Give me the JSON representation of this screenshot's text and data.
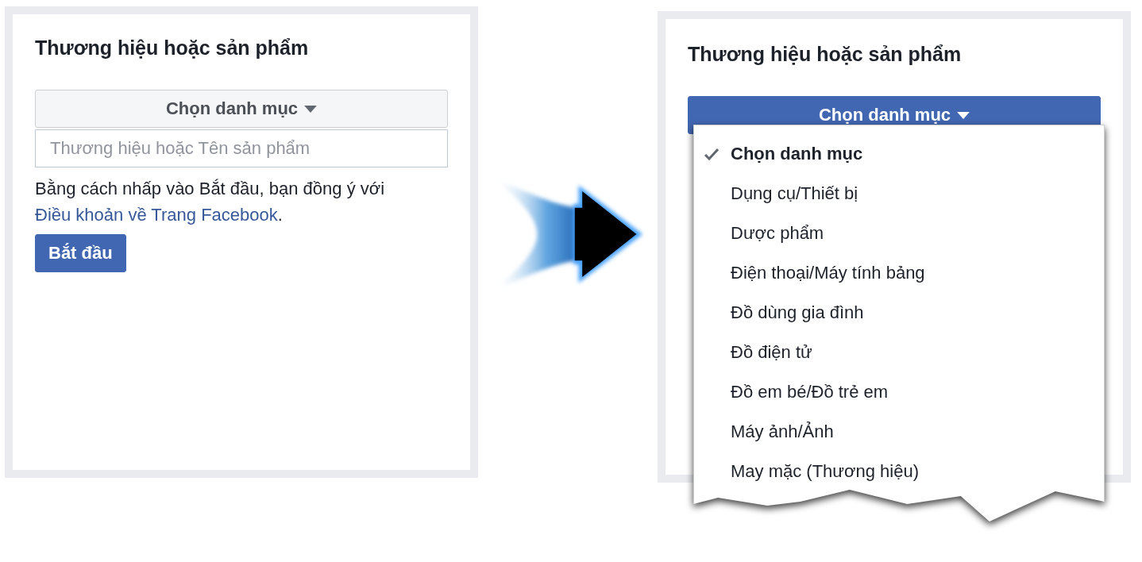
{
  "panels": [
    {
      "title": "Thương hiệu hoặc sản phẩm",
      "dropdown": {
        "label": "Chọn danh mục",
        "open": false
      },
      "input": {
        "placeholder": "Thương hiệu hoặc Tên sản phẩm"
      },
      "terms": {
        "before": "Bằng cách nhấp vào Bắt đầu, bạn đồng ý với",
        "link": "Điều khoản về Trang Facebook",
        "after": "."
      },
      "button": "Bắt đầu"
    },
    {
      "title": "Thương hiệu hoặc sản phẩm",
      "dropdown": {
        "label": "Chọn danh mục",
        "open": true
      },
      "menu": [
        {
          "label": "Chọn danh mục",
          "selected": true
        },
        {
          "label": "Dụng cụ/Thiết bị",
          "selected": false
        },
        {
          "label": "Dược phẩm",
          "selected": false
        },
        {
          "label": "Điện thoại/Máy tính bảng",
          "selected": false
        },
        {
          "label": "Đồ dùng gia đình",
          "selected": false
        },
        {
          "label": "Đồ điện tử",
          "selected": false
        },
        {
          "label": "Đồ em bé/Đồ trẻ em",
          "selected": false
        },
        {
          "label": "Máy ảnh/Ảnh",
          "selected": false
        },
        {
          "label": "May mặc (Thương hiệu)",
          "selected": false
        }
      ]
    }
  ]
}
